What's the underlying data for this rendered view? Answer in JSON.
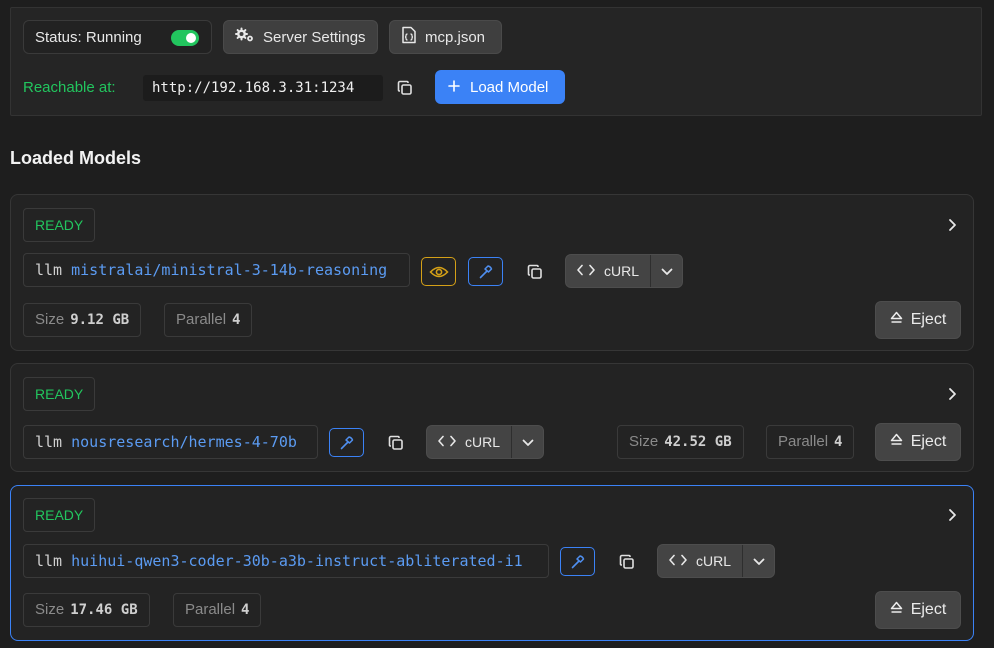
{
  "status": {
    "label": "Status: Running",
    "running": true
  },
  "toolbar": {
    "server_settings_label": "Server Settings",
    "mcp_label": "mcp.json",
    "load_model_label": "Load Model"
  },
  "reach": {
    "label": "Reachable at:",
    "url": "http://192.168.3.31:1234"
  },
  "section_title": "Loaded Models",
  "models": [
    {
      "status": "READY",
      "kind": "llm",
      "name": "mistralai/ministral-3-14b-reasoning",
      "size_label": "Size",
      "size": "9.12 GB",
      "parallel_label": "Parallel",
      "parallel": "4",
      "curl_label": "cURL",
      "eject_label": "Eject",
      "has_vision": true
    },
    {
      "status": "READY",
      "kind": "llm",
      "name": "nousresearch/hermes-4-70b",
      "size_label": "Size",
      "size": "42.52 GB",
      "parallel_label": "Parallel",
      "parallel": "4",
      "curl_label": "cURL",
      "eject_label": "Eject",
      "has_vision": false
    },
    {
      "status": "READY",
      "kind": "llm",
      "name": "huihui-qwen3-coder-30b-a3b-instruct-abliterated-i1",
      "size_label": "Size",
      "size": "17.46 GB",
      "parallel_label": "Parallel",
      "parallel": "4",
      "curl_label": "cURL",
      "eject_label": "Eject",
      "has_vision": false
    }
  ],
  "colors": {
    "accent": "#3b82f6",
    "ready": "#22c55e",
    "vision": "#d4a017"
  }
}
